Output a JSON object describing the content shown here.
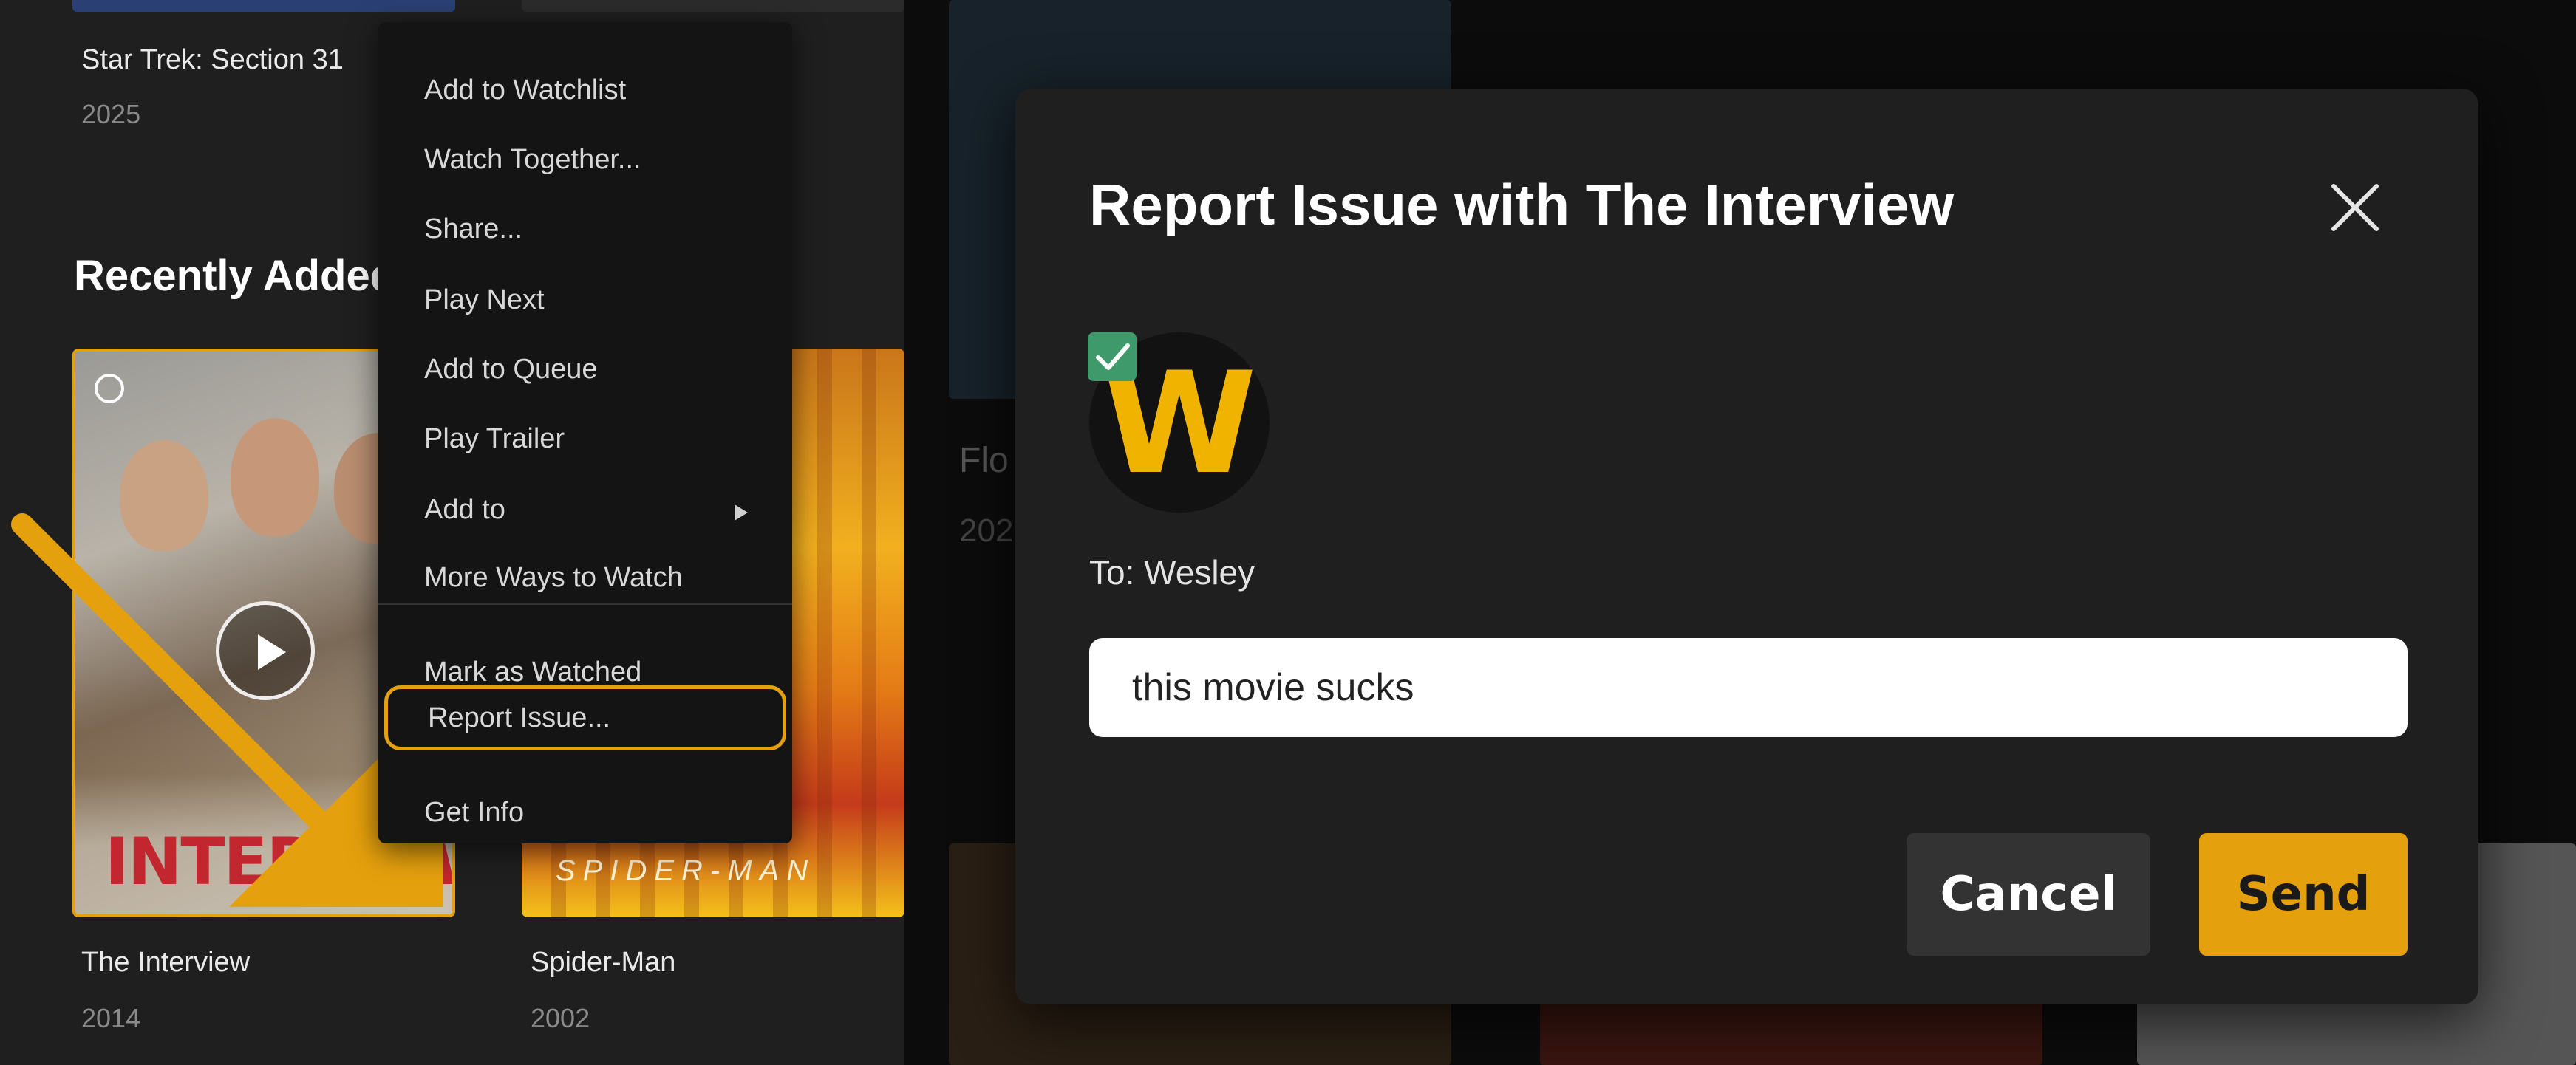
{
  "hub": {
    "top_row": {
      "title": "Star Trek: Section 31",
      "year": "2025"
    },
    "section_title": "Recently Added",
    "cards": [
      {
        "title": "The Interview",
        "year": "2014",
        "poster_text": "INTERVIEW"
      },
      {
        "title": "Spider-Man",
        "year": "2002",
        "poster_text": "SPIDER-MAN"
      }
    ],
    "background_card": {
      "title": "Flo",
      "year": "202"
    }
  },
  "context_menu": {
    "items": [
      {
        "label": "Add to Watchlist"
      },
      {
        "label": "Watch Together..."
      },
      {
        "label": "Share..."
      },
      {
        "label": "Play Next"
      },
      {
        "label": "Add to Queue"
      },
      {
        "label": "Play Trailer"
      },
      {
        "label": "Add to",
        "has_submenu": true
      },
      {
        "label": "More Ways to Watch"
      },
      {
        "label": "Mark as Watched"
      },
      {
        "label": "Report Issue...",
        "focused": true
      },
      {
        "label": "Get Info"
      }
    ]
  },
  "modal": {
    "title": "Report Issue with The Interview",
    "avatar_letter": "W",
    "recipient_label": "To: Wesley",
    "message_value": "this movie sucks",
    "cancel_label": "Cancel",
    "send_label": "Send"
  },
  "colors": {
    "accent": "#e5a00d",
    "modal_bg": "#1f1f1f",
    "check_green": "#3f9a6b"
  },
  "icons": {
    "close": "close-icon",
    "play": "play-icon",
    "submenu": "chevron-right-icon",
    "more": "more-vertical-icon",
    "select": "select-circle-icon",
    "check": "checkmark-icon",
    "annotation": "arrow-annotation-icon"
  }
}
